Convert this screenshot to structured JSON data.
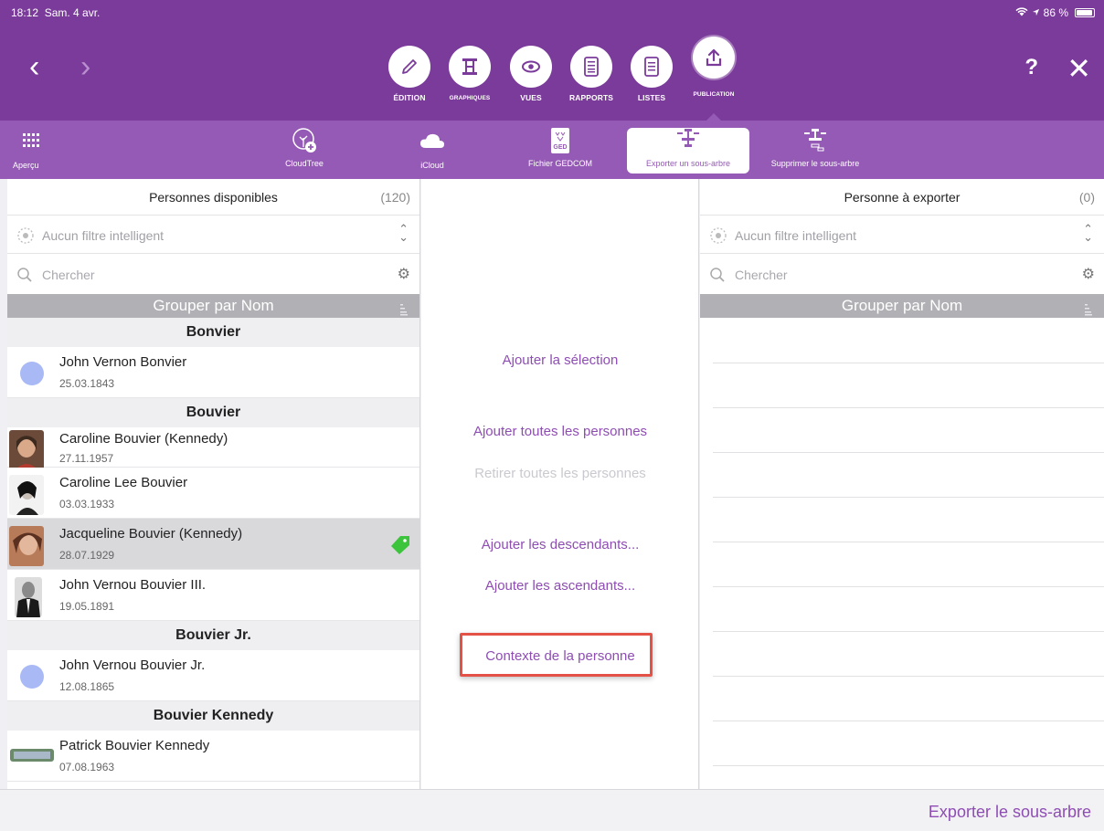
{
  "status": {
    "time": "18:12",
    "date": "Sam. 4 avr.",
    "battery": "86 %"
  },
  "topbar": {
    "back": "‹",
    "forward": "›",
    "help": "?",
    "close": "✕",
    "nav": [
      {
        "label": "ÉDITION",
        "icon": "pencil-icon"
      },
      {
        "label": "GRAPHIQUES",
        "icon": "chart-icon"
      },
      {
        "label": "VUES",
        "icon": "eye-icon"
      },
      {
        "label": "RAPPORTS",
        "icon": "document-icon"
      },
      {
        "label": "LISTES",
        "icon": "list-icon"
      },
      {
        "label": "PUBLICATION",
        "icon": "upload-icon"
      }
    ]
  },
  "subbar": {
    "items": [
      {
        "label": "Aperçu",
        "icon": "grid-icon"
      },
      {
        "label": "CloudTree",
        "icon": "cloudtree-icon"
      },
      {
        "label": "iCloud",
        "icon": "cloud-icon"
      },
      {
        "label": "Fichier GEDCOM",
        "icon": "ged-file-icon",
        "badge": "GED"
      },
      {
        "label": "Exporter un sous-arbre",
        "icon": "subtree-icon"
      },
      {
        "label": "Supprimer le sous-arbre",
        "icon": "subtree-remove-icon"
      }
    ]
  },
  "left": {
    "title": "Personnes disponibles",
    "count": "(120)",
    "filter": "Aucun filtre intelligent",
    "search_placeholder": "Chercher",
    "group_label": "Grouper par Nom",
    "groups": [
      {
        "name": "Bonvier",
        "people": [
          {
            "name": "John Vernon Bonvier",
            "date": "25.03.1843"
          }
        ]
      },
      {
        "name": "Bouvier",
        "people": [
          {
            "name": "Caroline Bouvier (Kennedy)",
            "date": "27.11.1957"
          },
          {
            "name": "Caroline Lee Bouvier",
            "date": "03.03.1933"
          },
          {
            "name": "Jacqueline Bouvier (Kennedy)",
            "date": "28.07.1929"
          },
          {
            "name": "John Vernou Bouvier III.",
            "date": "19.05.1891"
          }
        ]
      },
      {
        "name": "Bouvier Jr.",
        "people": [
          {
            "name": "John Vernou Bouvier Jr.",
            "date": "12.08.1865"
          }
        ]
      },
      {
        "name": "Bouvier Kennedy",
        "people": [
          {
            "name": "Patrick Bouvier Kennedy",
            "date": "07.08.1963"
          }
        ]
      }
    ]
  },
  "middle": {
    "add_selection": "Ajouter la sélection",
    "add_all": "Ajouter toutes les personnes",
    "remove_all": "Retirer toutes les personnes",
    "add_descendants": "Ajouter les descendants...",
    "add_ancestors": "Ajouter les ascendants...",
    "person_context": "Contexte de la personne"
  },
  "right": {
    "title": "Personne à exporter",
    "count": "(0)",
    "filter": "Aucun filtre intelligent",
    "search_placeholder": "Chercher",
    "group_label": "Grouper par Nom"
  },
  "bottom": {
    "export_label": "Exporter le sous-arbre"
  },
  "colors": {
    "primary": "#7b3b9b",
    "secondary": "#955ab5",
    "link": "#8e4db3",
    "highlight": "#e45146",
    "tag": "#3dc43d"
  }
}
